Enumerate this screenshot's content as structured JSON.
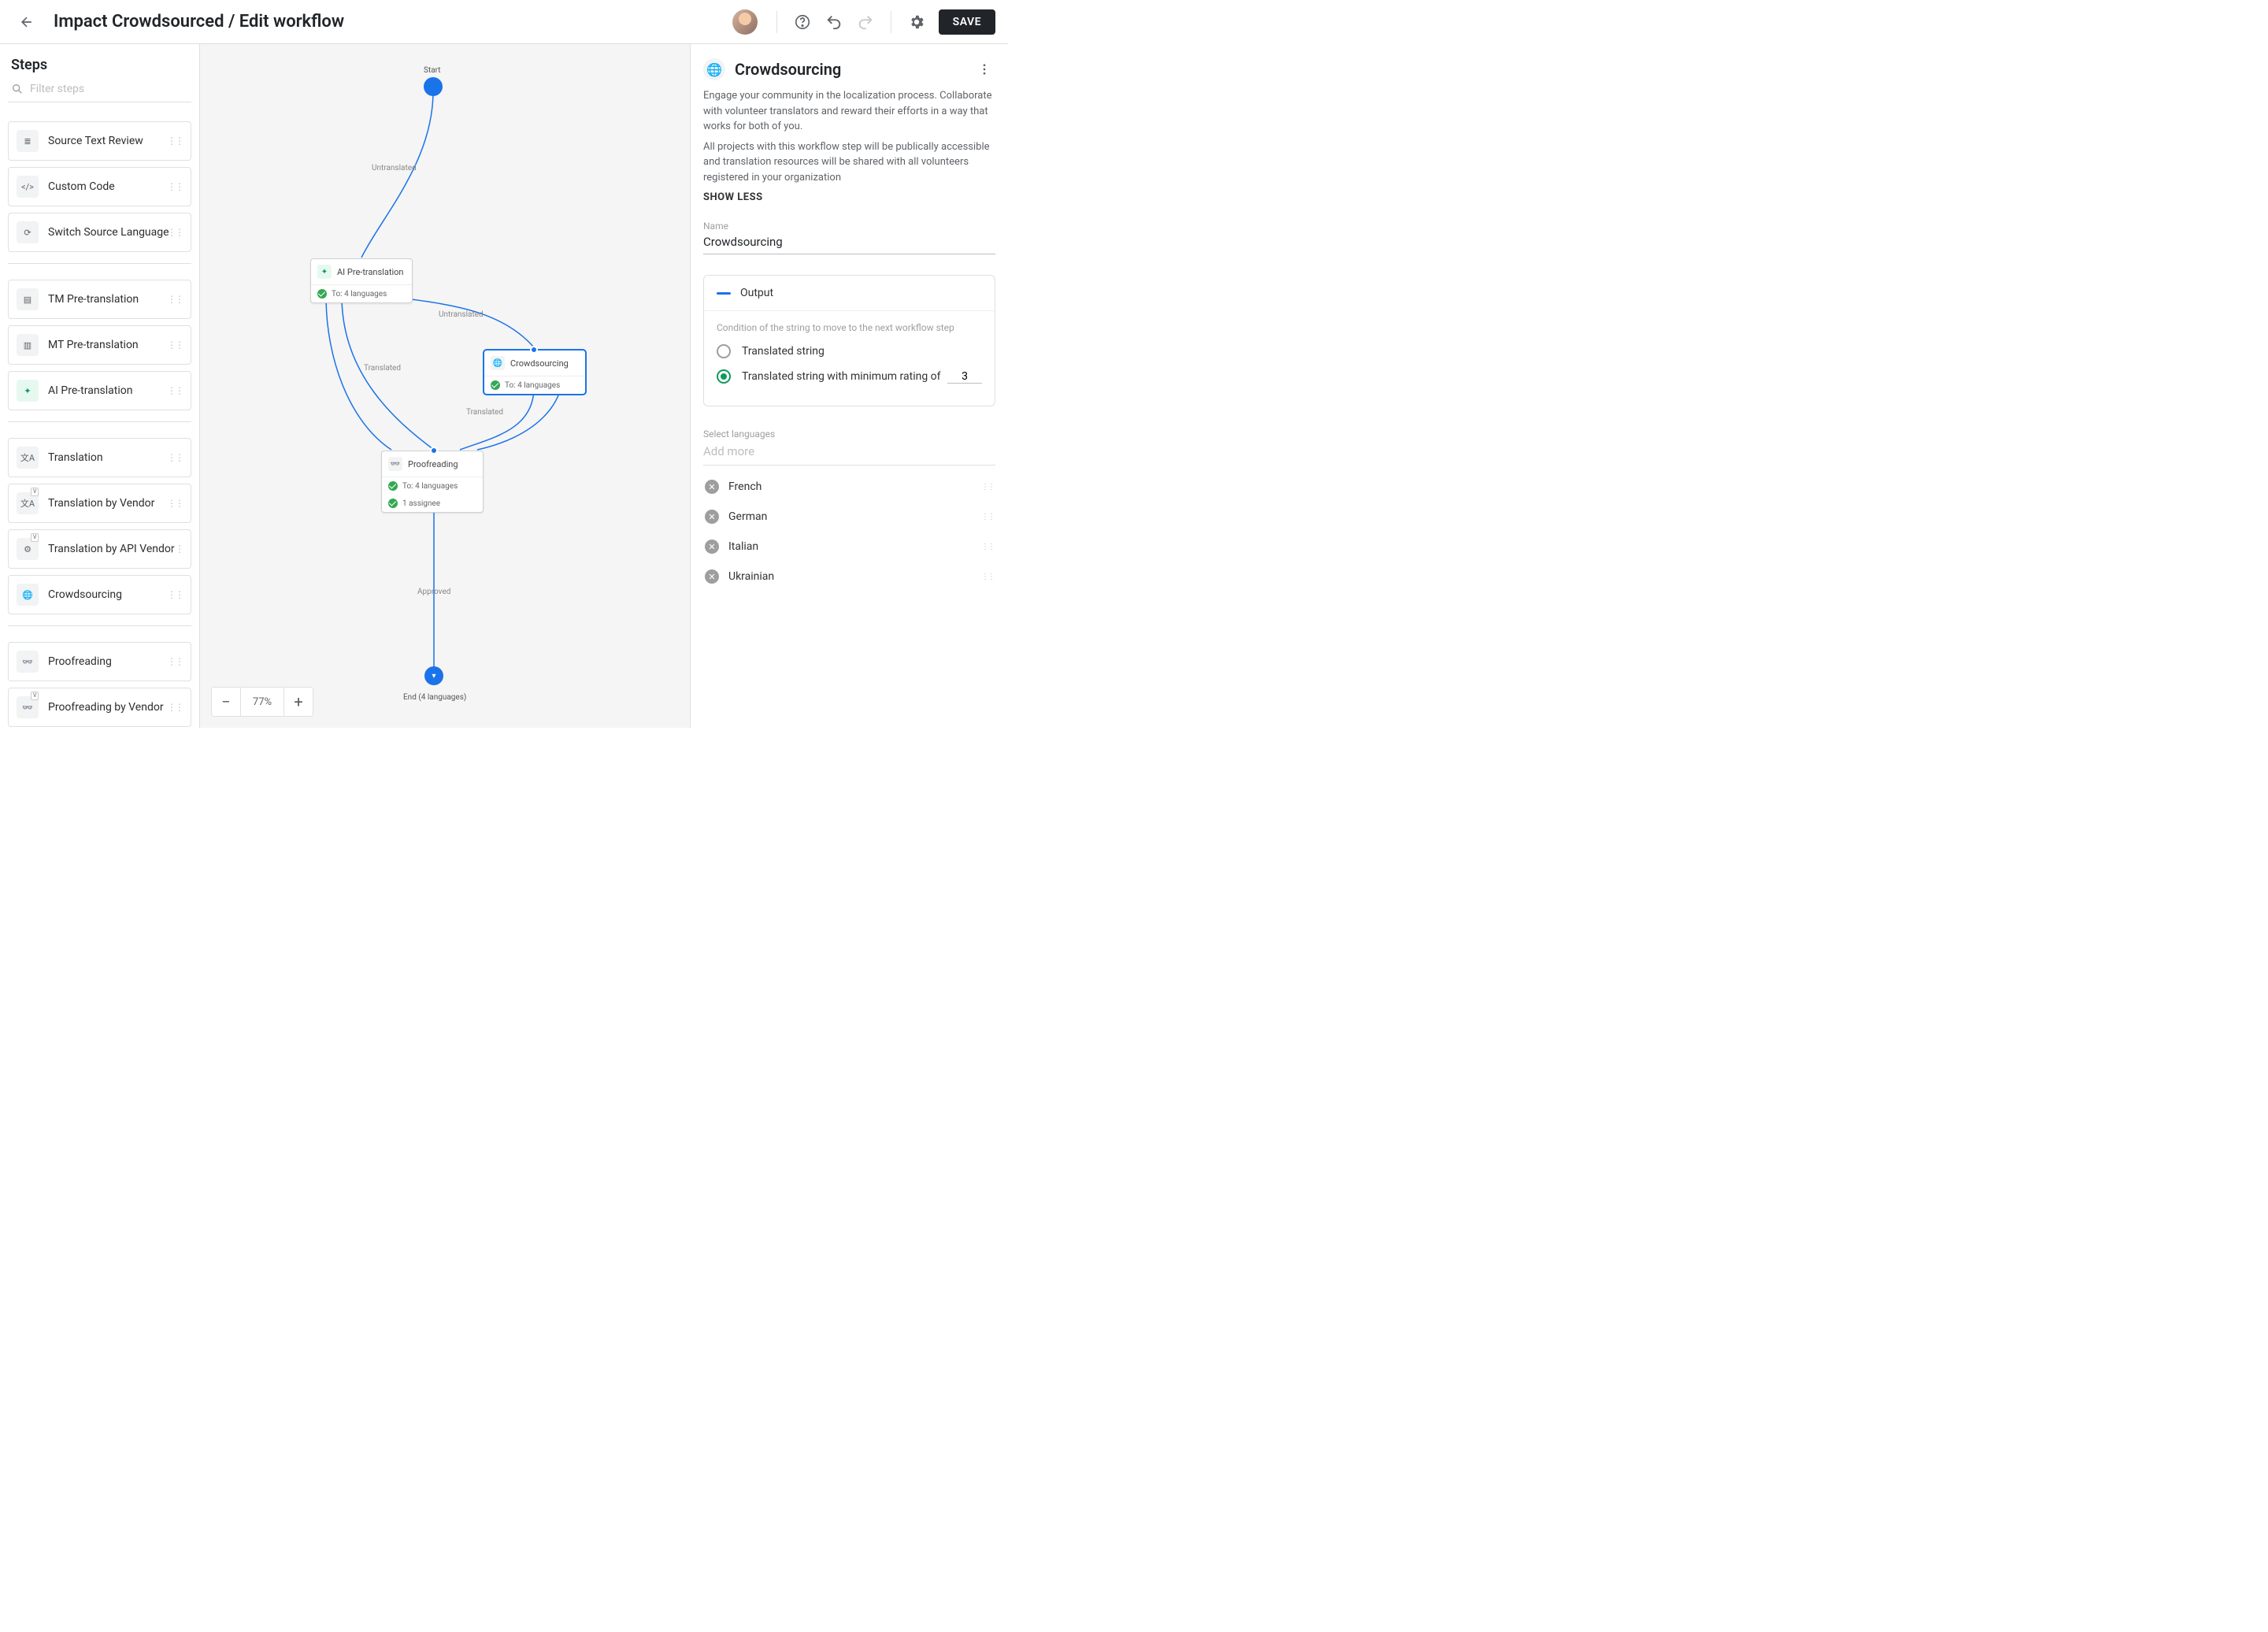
{
  "header": {
    "title": "Impact Crowdsourced / Edit workflow",
    "save_label": "SAVE"
  },
  "sidebar": {
    "heading": "Steps",
    "filter_placeholder": "Filter steps",
    "groups": [
      {
        "items": [
          {
            "id": "source-text-review",
            "label": "Source Text Review",
            "icon": "lines"
          },
          {
            "id": "custom-code",
            "label": "Custom Code",
            "icon": "code"
          },
          {
            "id": "switch-source-language",
            "label": "Switch Source Language",
            "icon": "sync"
          }
        ]
      },
      {
        "items": [
          {
            "id": "tm-pre-translation",
            "label": "TM Pre-translation",
            "icon": "tm"
          },
          {
            "id": "mt-pre-translation",
            "label": "MT Pre-translation",
            "icon": "mt"
          },
          {
            "id": "ai-pre-translation",
            "label": "AI Pre-translation",
            "icon": "ai"
          }
        ]
      },
      {
        "items": [
          {
            "id": "translation",
            "label": "Translation",
            "icon": "xa"
          },
          {
            "id": "translation-by-vendor",
            "label": "Translation by Vendor",
            "icon": "xa",
            "vendor": true
          },
          {
            "id": "translation-by-api-vendor",
            "label": "Translation by API Vendor",
            "icon": "gear",
            "vendor": true
          },
          {
            "id": "crowdsourcing",
            "label": "Crowdsourcing",
            "icon": "globe"
          }
        ]
      },
      {
        "items": [
          {
            "id": "proofreading",
            "label": "Proofreading",
            "icon": "oo"
          },
          {
            "id": "proofreading-by-vendor",
            "label": "Proofreading by Vendor",
            "icon": "oo",
            "vendor": true
          }
        ]
      }
    ]
  },
  "canvas": {
    "zoom": "77%",
    "start_label": "Start",
    "end_label": "End (4 languages)",
    "edges": {
      "untranslated": "Untranslated",
      "translated": "Translated",
      "translated2": "Translated",
      "untranslated2": "Untranslated",
      "approved": "Approved"
    },
    "nodes": {
      "ai": {
        "title": "AI Pre-translation",
        "sub": "To: 4 languages"
      },
      "crowd": {
        "title": "Crowdsourcing",
        "sub": "To: 4 languages"
      },
      "proof": {
        "title": "Proofreading",
        "sub1": "To: 4 languages",
        "sub2": "1 assignee"
      }
    }
  },
  "panel": {
    "title": "Crowdsourcing",
    "desc1": "Engage your community in the localization process. Collaborate with volunteer translators and reward their efforts in a way that works for both of you.",
    "desc2": "All projects with this workflow step will be publically accessible and translation resources will be shared with all volunteers registered in your organization",
    "show_less": "SHOW LESS",
    "name_label": "Name",
    "name_value": "Crowdsourcing",
    "output": {
      "title": "Output",
      "condition_hint": "Condition of the string to move to the next workflow step",
      "opt1": "Translated string",
      "opt2": "Translated string with minimum rating of",
      "rating": "3"
    },
    "languages": {
      "label": "Select languages",
      "add_more": "Add more",
      "list": [
        "French",
        "German",
        "Italian",
        "Ukrainian"
      ]
    }
  }
}
